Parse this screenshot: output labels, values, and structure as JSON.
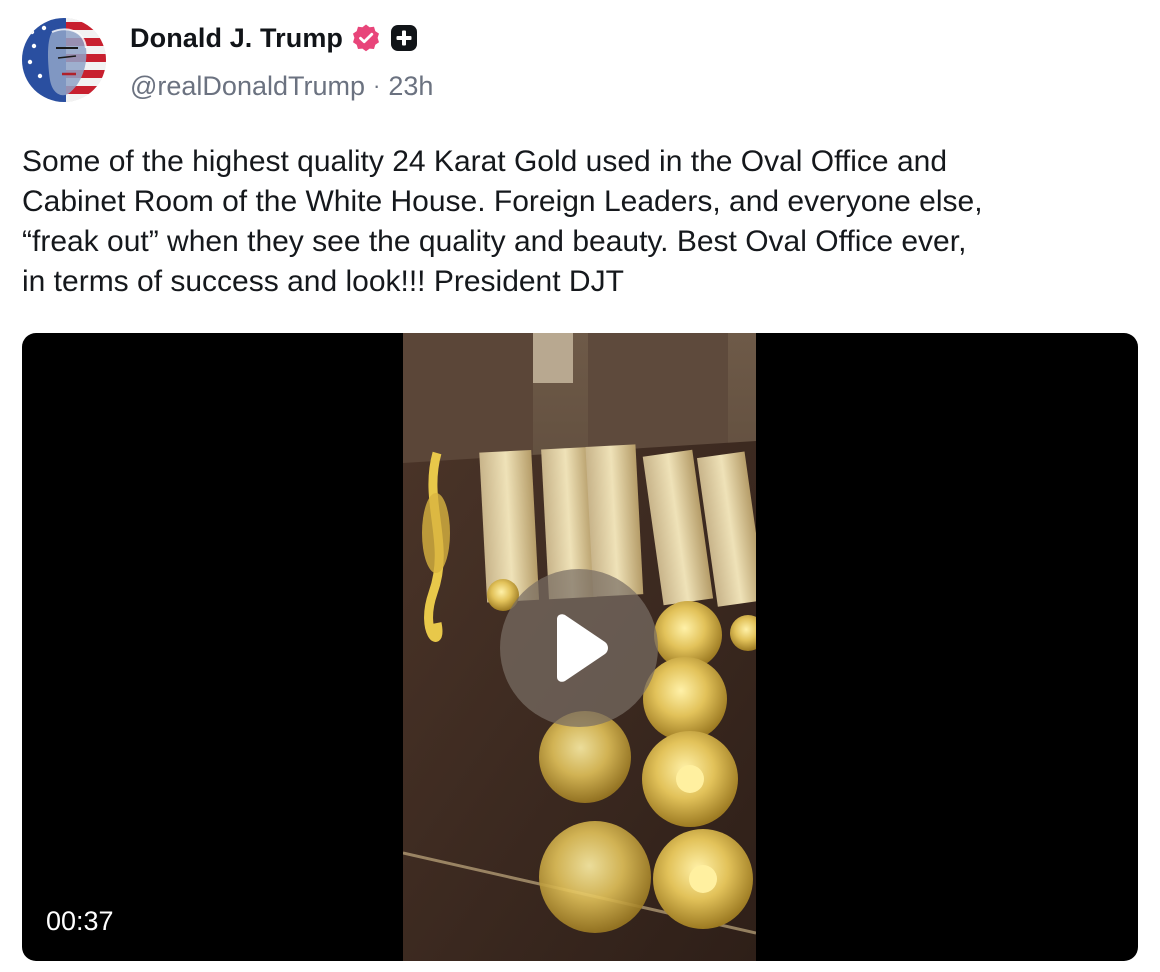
{
  "author": {
    "display_name": "Donald J. Trump",
    "handle": "@realDonaldTrump",
    "separator": "·",
    "time_ago": "23h",
    "verified_color": "#e8457a"
  },
  "post": {
    "text": "Some of the highest quality 24 Karat Gold used in the Oval Office and\nCabinet Room of the White House. Foreign Leaders, and everyone else,\n“freak out” when they see the quality and beauty. Best Oval Office ever,\nin terms of success and look!!! President DJT"
  },
  "media": {
    "type": "video",
    "duration": "00:37",
    "play_icon": "play-icon"
  },
  "icons": {
    "verified": "verified-badge-icon",
    "plus": "plus-badge-icon"
  }
}
